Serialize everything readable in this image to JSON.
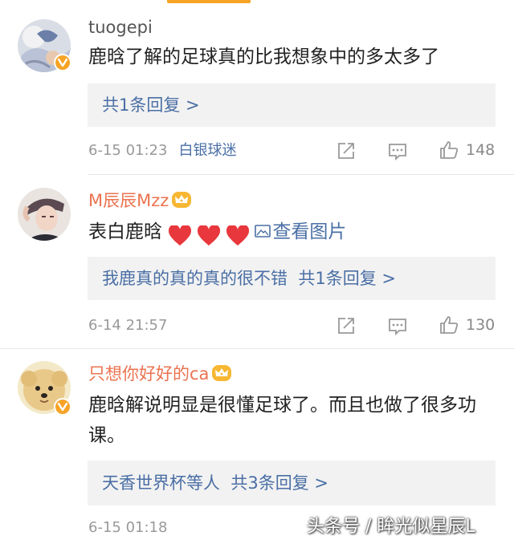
{
  "comments": [
    {
      "username": "tuogepi",
      "text": "鹿晗了解的足球真的比我想象中的多太多了",
      "reply_summary": "共1条回复 >",
      "date": "6-15 01:23",
      "tag": "白银球迷",
      "likes": "148"
    },
    {
      "username": "M辰辰Mzz",
      "text": "表白鹿晗",
      "view_image": "查看图片",
      "reply_preview": "我鹿真的真的真的很不错",
      "reply_summary": "共1条回复 >",
      "date": "6-14 21:57",
      "likes": "130"
    },
    {
      "username": "只想你好好的ca",
      "text": "鹿晗解说明显是很懂足球了。而且也做了很多功课。",
      "reply_preview": "天香世界杯等人",
      "reply_summary": "共3条回复 >",
      "date": "6-15 01:18"
    }
  ],
  "watermark": "头条号 / 眸光似星辰L",
  "colors": {
    "accent": "#f7a325",
    "link": "#4a6fa5",
    "vip_name": "#eb7350",
    "heart": "#e8383d",
    "reply_bg": "#f2f2f2"
  }
}
